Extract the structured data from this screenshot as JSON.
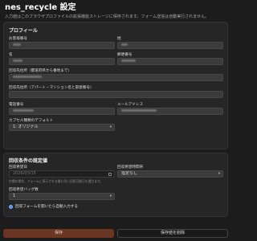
{
  "header": {
    "title": "nes_recycle 設定",
    "subtitle": "入力値はこのブラウザプロファイルの拡張機能ストレージに保存されます。フォーム送信は自動実行されません。"
  },
  "profile": {
    "section_title": "プロフィール",
    "postal_code_label": "お客様番号",
    "last_name_label": "姓",
    "first_name_label": "名",
    "phone_sub_label": "郵便番号",
    "address1_label": "回収先住所（都道府県から番地まで）",
    "address2_label": "回収先住所（アパート・マンション名と部屋番号）",
    "phone_label": "電話番号",
    "email_label": "メールアドレス",
    "capsule_label": "カプセル種類のデフォルト",
    "capsule_value": "1: オリジナル"
  },
  "schedule": {
    "section_title": "回収条件の既定値",
    "date_label": "回収希望日",
    "date_placeholder": "2026/03/15",
    "date_hint": "空欄の場合、フォームに表示される最も早い回収可能日を選びます。",
    "time_label": "回収希望時間帯",
    "time_value": "指定なし",
    "bag_label": "回収希望バッグ数",
    "bag_value": "1",
    "auto_fill_label": "回収フォームを開いたら自動入力する"
  },
  "actions": {
    "save_label": "保存",
    "delete_label": "保存値を削除"
  },
  "colors": {
    "background": "#1c1c1c",
    "card": "#262626",
    "input": "#3b3b3b",
    "save_button": "#6a3622",
    "check_accent": "#4c8df6"
  }
}
